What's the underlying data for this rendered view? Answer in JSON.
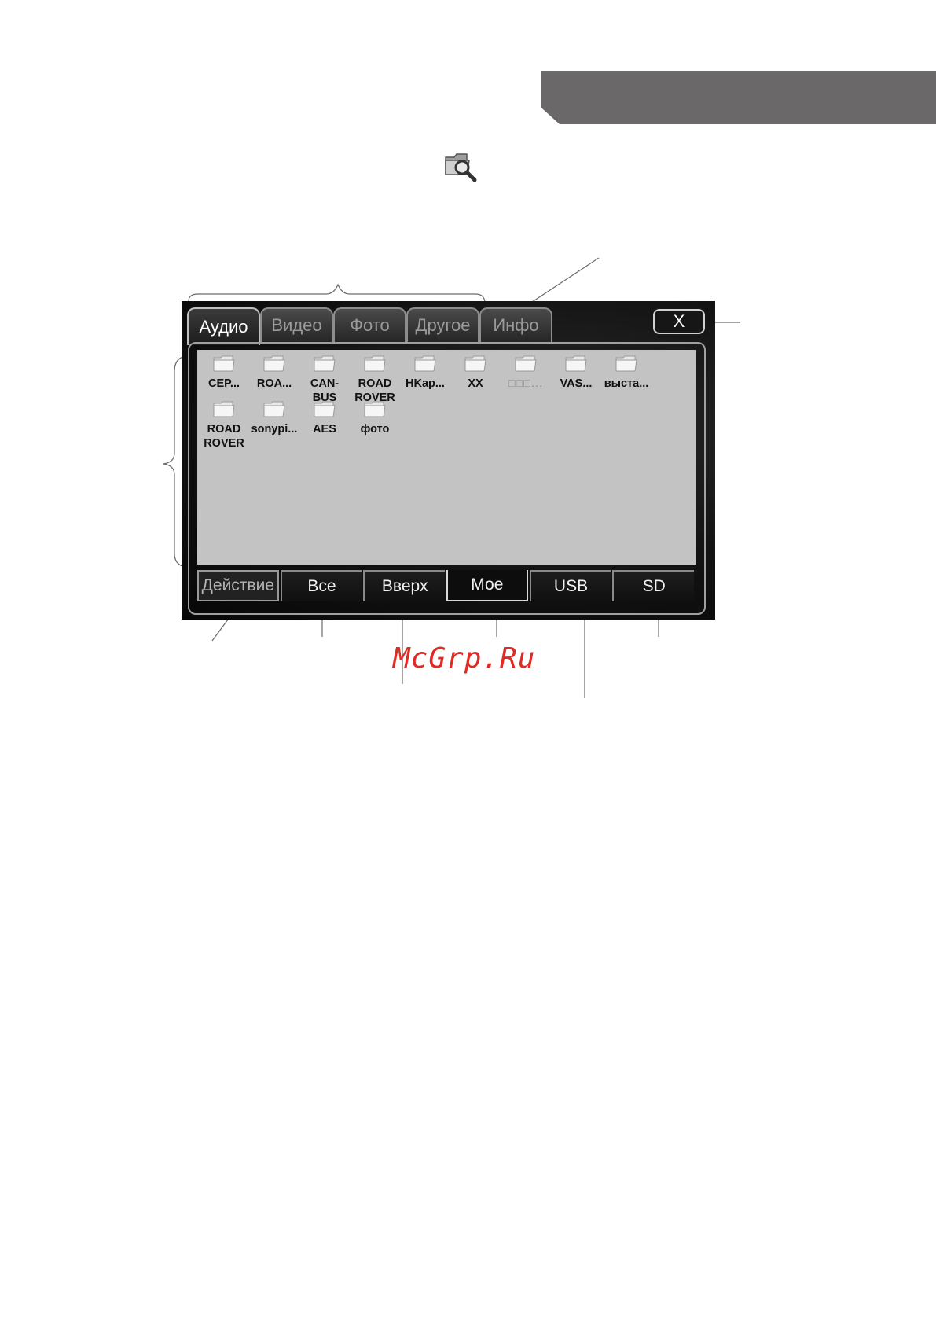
{
  "tabs": [
    {
      "label": "Аудио",
      "active": true
    },
    {
      "label": "Видео",
      "active": false
    },
    {
      "label": "Фото",
      "active": false
    },
    {
      "label": "Другое",
      "active": false
    },
    {
      "label": "Инфо",
      "active": false
    }
  ],
  "close_label": "X",
  "files": [
    {
      "name": "CEP..."
    },
    {
      "name": "ROA..."
    },
    {
      "name": "CAN-\nBUS"
    },
    {
      "name": "ROAD\nROVER"
    },
    {
      "name": "HKap..."
    },
    {
      "name": "XX"
    },
    {
      "name": "□□□...",
      "dim": true
    },
    {
      "name": "VAS..."
    },
    {
      "name": "выста..."
    },
    {
      "name": "ROAD\nROVER"
    },
    {
      "name": "sonypi..."
    },
    {
      "name": "AES"
    },
    {
      "name": "фото"
    }
  ],
  "bottom_buttons": [
    {
      "label": "Действие"
    },
    {
      "label": "Все"
    },
    {
      "label": "Вверх"
    },
    {
      "label": "Мое"
    },
    {
      "label": "USB"
    },
    {
      "label": "SD"
    }
  ],
  "watermark": "McGrp.Ru",
  "colors": {
    "header_bar": "#6a6868",
    "watermark": "#e02a24",
    "file_panel": "#c3c3c3"
  }
}
